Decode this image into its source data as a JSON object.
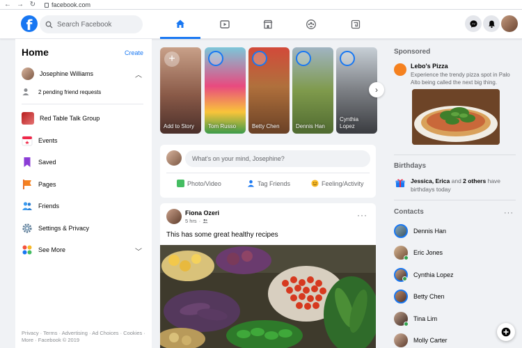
{
  "browser": {
    "url": "facebook.com"
  },
  "topnav": {
    "logo_letter": "f",
    "search_placeholder": "Search Facebook",
    "tabs": [
      {
        "name": "home",
        "icon": "home-icon",
        "active": true
      },
      {
        "name": "watch",
        "icon": "video-icon",
        "active": false
      },
      {
        "name": "marketplace",
        "icon": "marketplace-icon",
        "active": false
      },
      {
        "name": "groups",
        "icon": "groups-icon",
        "active": false
      },
      {
        "name": "gaming",
        "icon": "gaming-icon",
        "active": false
      }
    ],
    "accent": "#1877f2"
  },
  "left": {
    "title": "Home",
    "create_label": "Create",
    "profile_name": "Josephine Williams",
    "friend_requests": "2 pending friend requests",
    "items": [
      {
        "label": "Red Table Talk Group",
        "icon": "group-thumbnail-icon"
      },
      {
        "label": "Events",
        "icon": "calendar-icon"
      },
      {
        "label": "Saved",
        "icon": "bookmark-icon"
      },
      {
        "label": "Pages",
        "icon": "flag-icon"
      },
      {
        "label": "Friends",
        "icon": "friends-icon"
      },
      {
        "label": "Settings & Privacy",
        "icon": "gear-icon"
      },
      {
        "label": "See More",
        "icon": "grid-icon"
      }
    ],
    "footer": "Privacy · Terms · Advertising · Ad Choices · Cookies · More · Facebook © 2019"
  },
  "stories": [
    {
      "label": "Add to Story",
      "type": "create"
    },
    {
      "label": "Tom Russo"
    },
    {
      "label": "Betty Chen"
    },
    {
      "label": "Dennis Han"
    },
    {
      "label": "Cynthia Lopez"
    }
  ],
  "composer": {
    "placeholder": "What's on your mind, Josephine?",
    "actions": [
      {
        "label": "Photo/Video",
        "color": "#45bd62"
      },
      {
        "label": "Tag Friends",
        "color": "#1877f2"
      },
      {
        "label": "Feeling/Activity",
        "color": "#f7b928"
      }
    ]
  },
  "post": {
    "author": "Fiona Ozeri",
    "time": "5 hrs",
    "text": "This has some great healthy recipes"
  },
  "right": {
    "sponsored_title": "Sponsored",
    "ad_name": "Lebo's Pizza",
    "ad_desc": "Experience the trendy pizza spot in Palo Alto being called the next big thing.",
    "birthdays_title": "Birthdays",
    "birthday_names": "Jessica, Erica",
    "birthday_and": " and ",
    "birthday_others": "2 others",
    "birthday_rest": " have birthdays today",
    "contacts_title": "Contacts",
    "contacts": [
      {
        "name": "Dennis Han",
        "online": false
      },
      {
        "name": "Eric Jones",
        "online": true
      },
      {
        "name": "Cynthia Lopez",
        "online": true
      },
      {
        "name": "Betty Chen",
        "online": false
      },
      {
        "name": "Tina Lim",
        "online": true
      },
      {
        "name": "Molly Carter",
        "online": false
      }
    ]
  }
}
